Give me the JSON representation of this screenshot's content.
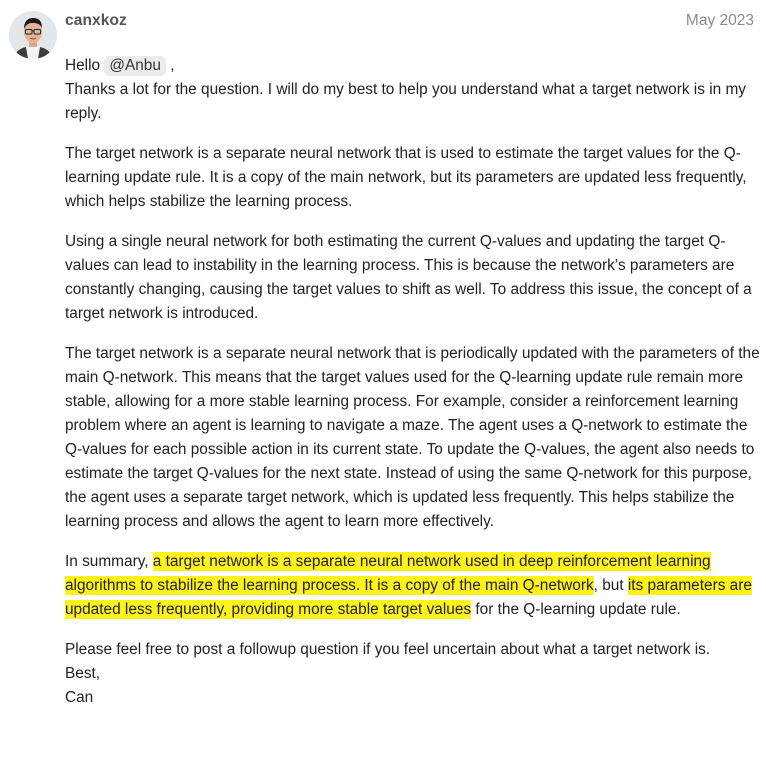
{
  "post": {
    "author": "canxkoz",
    "date": "May 2023",
    "greeting_before": "Hello ",
    "mention": "@Anbu",
    "greeting_after": " ,",
    "intro": "Thanks a lot for the question. I will do my best to help you understand what a target network is in my reply.",
    "paragraphs": [
      "The target network is a separate neural network that is used to estimate the target values for the Q-learning update rule. It is a copy of the main network, but its parameters are updated less frequently, which helps stabilize the learning process.",
      "Using a single neural network for both estimating the current Q-values and updating the target Q-values can lead to instability in the learning process. This is because the network’s parameters are constantly changing, causing the target values to shift as well. To address this issue, the concept of a target network is introduced.",
      "The target network is a separate neural network that is periodically updated with the parameters of the main Q-network. This means that the target values used for the Q-learning update rule remain more stable, allowing for a more stable learning process. For example, consider a reinforcement learning problem where an agent is learning to navigate a maze. The agent uses a Q-network to estimate the Q-values for each possible action in its current state. To update the Q-values, the agent also needs to estimate the target Q-values for the next state. Instead of using the same Q-network for this purpose, the agent uses a separate target network, which is updated less frequently. This helps stabilize the learning process and allows the agent to learn more effectively."
    ],
    "summary": {
      "prefix": "In summary, ",
      "highlight_1": "a target network is a separate neural network used in deep reinforcement learning algorithms to stabilize the learning process. It is a copy of the main Q-network",
      "middle": ", but ",
      "highlight_2": "its parameters are updated less frequently, providing more stable target values",
      "suffix": " for the Q-learning update rule."
    },
    "closing": "Please feel free to post a followup question if you feel uncertain about what a target network is.",
    "signoff": "Best,",
    "signature": "Can"
  },
  "colors": {
    "highlight": "#fdf21b",
    "mention_bg": "#ebebeb",
    "username": "#555555",
    "date": "#8a8a8a"
  },
  "icons": {
    "avatar": "user-avatar-photo"
  }
}
